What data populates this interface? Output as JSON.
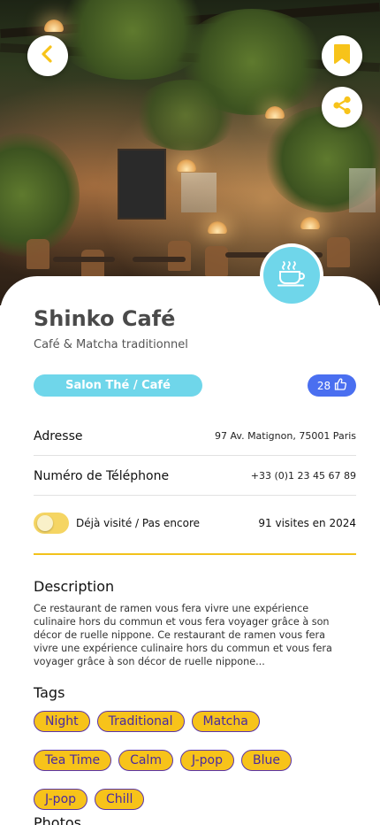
{
  "header": {
    "back_icon": "chevron-left-icon",
    "bookmark_icon": "bookmark-icon",
    "share_icon": "share-icon",
    "accent_color": "#f7c31a"
  },
  "place": {
    "category_icon": "coffee-cup-icon",
    "name": "Shinko Café",
    "subtitle": "Café & Matcha traditionnel",
    "type_label": "Salon Thé / Café",
    "likes": "28",
    "type_color": "#6fd6ea",
    "likes_color": "#4a6ff0"
  },
  "info": {
    "address_label": "Adresse",
    "address_value": "97 Av. Matignon, 75001 Paris",
    "phone_label": "Numéro de Téléphone",
    "phone_value": "+33 (0)1 23 45 67 89"
  },
  "visit": {
    "toggle_label": "Déjà visité / Pas encore",
    "visits_count": "91 visites en 2024"
  },
  "description": {
    "heading": "Description",
    "text": "Ce restaurant de ramen vous fera vivre une expérience culinaire hors du commun et vous fera voyager grâce à son décor de ruelle nippone. Ce restaurant de ramen vous fera vivre une expérience culinaire hors du commun et vous fera voyager grâce à son décor de ruelle nippone..."
  },
  "tags": {
    "heading": "Tags",
    "items": [
      "Night",
      "Traditional",
      "Matcha",
      "Tea Time",
      "Calm",
      "J-pop",
      "Blue",
      "J-pop",
      "Chill"
    ]
  },
  "photos": {
    "heading": "Photos"
  }
}
